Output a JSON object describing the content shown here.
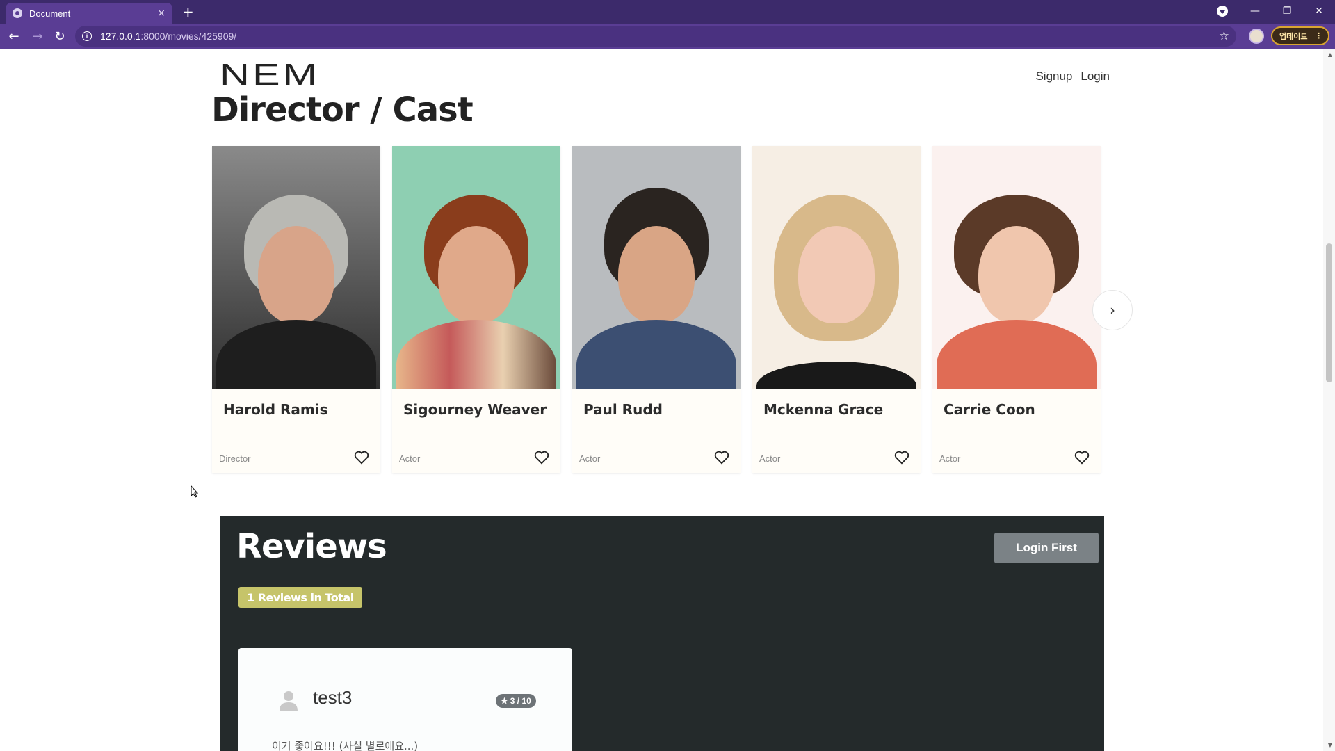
{
  "browser": {
    "tab_title": "Document",
    "tab_close": "×",
    "new_tab": "+",
    "url_host": "127.0.0.1",
    "url_path": ":8000/movies/425909/",
    "update_label": "업데이트",
    "update_menu": "⋮"
  },
  "site": {
    "logo": "NEM",
    "nav": {
      "signup": "Signup",
      "login": "Login"
    }
  },
  "cast_section": {
    "title": "Director / Cast",
    "cards": [
      {
        "name": "Harold Ramis",
        "role": "Director"
      },
      {
        "name": "Sigourney Weaver",
        "role": "Actor"
      },
      {
        "name": "Paul Rudd",
        "role": "Actor"
      },
      {
        "name": "Mckenna Grace",
        "role": "Actor"
      },
      {
        "name": "Carrie Coon",
        "role": "Actor"
      }
    ],
    "next_arrow": "›"
  },
  "reviews": {
    "title": "Reviews",
    "login_button": "Login First",
    "total_badge": "1 Reviews in Total",
    "items": [
      {
        "user": "test3",
        "rating": "3 / 10",
        "text": "이거 좋아요!!! (사실 별로에요...)"
      }
    ]
  },
  "colors": {
    "tab_bar": "#3c2a6b",
    "toolbar": "#5a3d94",
    "reviews_bg": "#242a2b",
    "badge": "#c6c46a",
    "login_button": "#7b8286"
  }
}
